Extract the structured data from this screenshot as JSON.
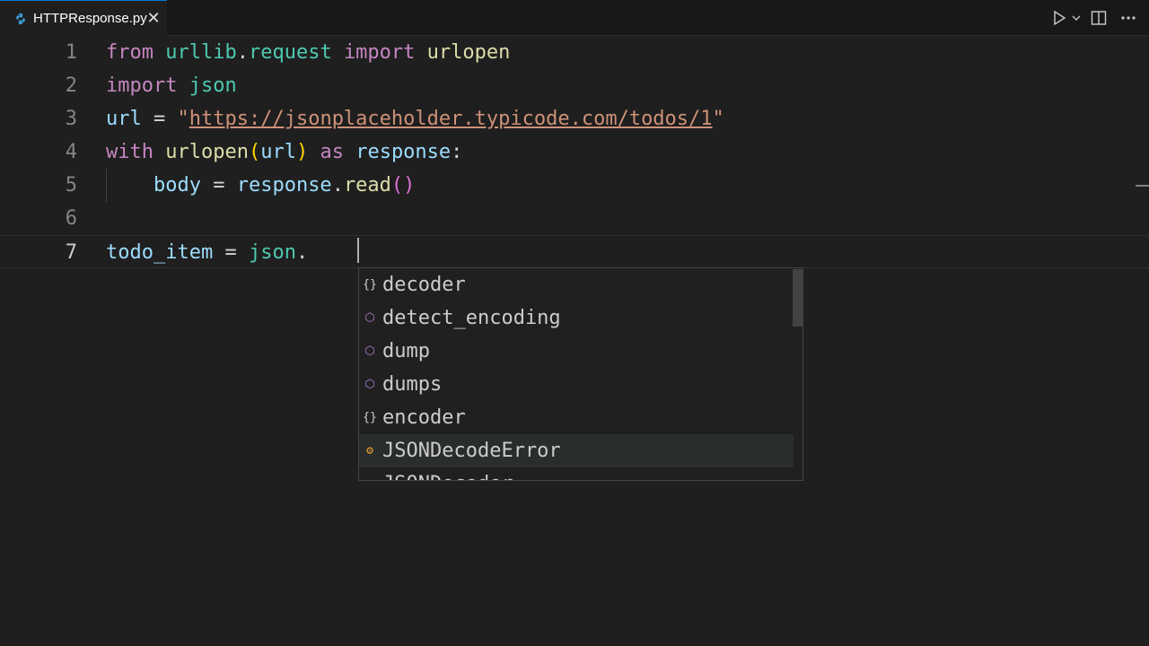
{
  "tab": {
    "title": "HTTPResponse.py",
    "icon": "python-icon",
    "close_glyph": "✕"
  },
  "toolbar": {
    "run_icon": "play-icon",
    "dropdown_icon": "chevron-down-icon",
    "split_icon": "split-editor-icon",
    "more_icon": "more-icon"
  },
  "editor": {
    "line_numbers": [
      "1",
      "2",
      "3",
      "4",
      "5",
      "6",
      "7"
    ],
    "active_line": 7,
    "lines": [
      [
        {
          "t": "from",
          "c": "kw"
        },
        {
          "t": " ",
          "c": "op"
        },
        {
          "t": "urllib",
          "c": "mod"
        },
        {
          "t": ".",
          "c": "op"
        },
        {
          "t": "request",
          "c": "mod"
        },
        {
          "t": " ",
          "c": "op"
        },
        {
          "t": "import",
          "c": "kw"
        },
        {
          "t": " ",
          "c": "op"
        },
        {
          "t": "urlopen",
          "c": "fn"
        }
      ],
      [
        {
          "t": "import",
          "c": "kw"
        },
        {
          "t": " ",
          "c": "op"
        },
        {
          "t": "json",
          "c": "mod"
        }
      ],
      [
        {
          "t": "url",
          "c": "var"
        },
        {
          "t": " = ",
          "c": "op"
        },
        {
          "t": "\"",
          "c": "str"
        },
        {
          "t": "https://jsonplaceholder.typicode.com/todos/1",
          "c": "url"
        },
        {
          "t": "\"",
          "c": "str"
        }
      ],
      [
        {
          "t": "with",
          "c": "kw"
        },
        {
          "t": " ",
          "c": "op"
        },
        {
          "t": "urlopen",
          "c": "fn"
        },
        {
          "t": "(",
          "c": "par"
        },
        {
          "t": "url",
          "c": "var"
        },
        {
          "t": ")",
          "c": "par"
        },
        {
          "t": " ",
          "c": "op"
        },
        {
          "t": "as",
          "c": "kw"
        },
        {
          "t": " ",
          "c": "op"
        },
        {
          "t": "response",
          "c": "var"
        },
        {
          "t": ":",
          "c": "op"
        }
      ],
      [
        {
          "t": "    ",
          "c": "op"
        },
        {
          "t": "body",
          "c": "var"
        },
        {
          "t": " = ",
          "c": "op"
        },
        {
          "t": "response",
          "c": "var"
        },
        {
          "t": ".",
          "c": "op"
        },
        {
          "t": "read",
          "c": "fn"
        },
        {
          "t": "()",
          "c": "par2"
        }
      ],
      [],
      [
        {
          "t": "todo_item",
          "c": "var"
        },
        {
          "t": " = ",
          "c": "op"
        },
        {
          "t": "json",
          "c": "mod"
        },
        {
          "t": ".",
          "c": "op"
        }
      ]
    ]
  },
  "suggest": {
    "items": [
      {
        "label": "decoder",
        "kind": "module",
        "icon_glyph": "{}",
        "selected": false
      },
      {
        "label": "detect_encoding",
        "kind": "function",
        "icon_glyph": "⬡",
        "selected": false
      },
      {
        "label": "dump",
        "kind": "function",
        "icon_glyph": "⬡",
        "selected": false
      },
      {
        "label": "dumps",
        "kind": "function",
        "icon_glyph": "⬡",
        "selected": false
      },
      {
        "label": "encoder",
        "kind": "module",
        "icon_glyph": "{}",
        "selected": false
      },
      {
        "label": "JSONDecodeError",
        "kind": "class",
        "icon_glyph": "⚙",
        "selected": true
      },
      {
        "label": "JSONDecoder",
        "kind": "class",
        "icon_glyph": "⚙",
        "selected": false
      }
    ]
  },
  "colors": {
    "background": "#1f1f1f",
    "keyword": "#c586c0",
    "variable": "#9cdcfe",
    "function": "#dcdcaa",
    "module": "#4ec9b0",
    "string": "#ce9178",
    "accent": "#0078d4"
  }
}
